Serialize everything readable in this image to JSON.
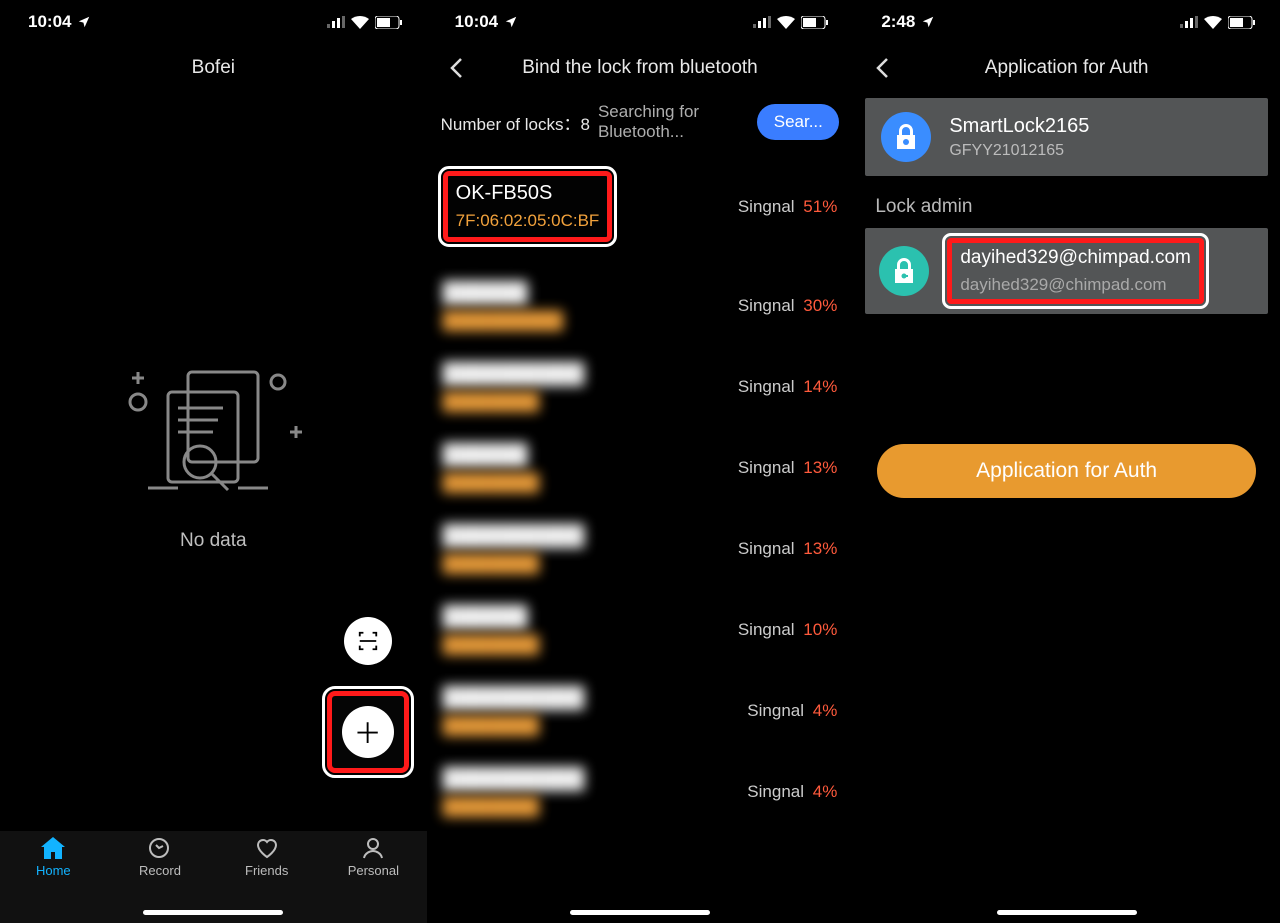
{
  "screen1": {
    "status": {
      "time": "10:04"
    },
    "title": "Bofei",
    "empty_text": "No data",
    "tabs": [
      "Home",
      "Record",
      "Friends",
      "Personal"
    ]
  },
  "screen2": {
    "status": {
      "time": "10:04"
    },
    "title": "Bind the lock from bluetooth",
    "count_label": "Number of locks：",
    "count_value": "8",
    "searching_text": "Searching for Bluetooth...",
    "search_button": "Sear...",
    "signal_label": "Singnal",
    "locks": [
      {
        "name": "OK-FB50S",
        "mac": "7F:06:02:05:0C:BF",
        "signal": "51%"
      },
      {
        "name": "██████",
        "mac": "██████████",
        "signal": "30%"
      },
      {
        "name": "██████████",
        "mac": "████████",
        "signal": "14%"
      },
      {
        "name": "██████",
        "mac": "████████",
        "signal": "13%"
      },
      {
        "name": "██████████",
        "mac": "████████",
        "signal": "13%"
      },
      {
        "name": "██████",
        "mac": "████████",
        "signal": "10%"
      },
      {
        "name": "██████████",
        "mac": "████████",
        "signal": "4%"
      },
      {
        "name": "██████████",
        "mac": "████████",
        "signal": "4%"
      }
    ]
  },
  "screen3": {
    "status": {
      "time": "2:48"
    },
    "title": "Application for Auth",
    "device": {
      "name": "SmartLock2165",
      "serial": "GFYY21012165"
    },
    "section_label": "Lock admin",
    "admin": {
      "email_top": "dayihed329@chimpad.com",
      "email_bottom": "dayihed329@chimpad.com"
    },
    "auth_button": "Application for Auth"
  }
}
